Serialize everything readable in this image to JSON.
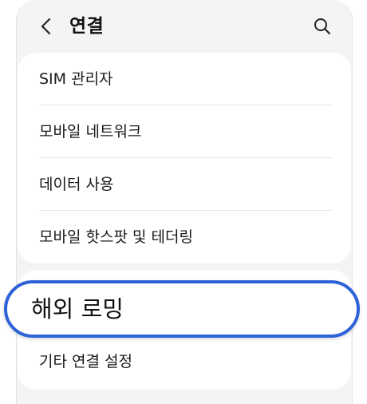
{
  "header": {
    "title": "연결",
    "back_icon": "chevron-left-icon",
    "search_icon": "search-icon"
  },
  "connection_menu": {
    "items": [
      {
        "label": "SIM 관리자"
      },
      {
        "label": "모바일 네트워크"
      },
      {
        "label": "데이터 사용"
      },
      {
        "label": "모바일 핫스팟 및 테더링"
      }
    ]
  },
  "highlighted_item": {
    "label": "해외 로밍",
    "highlight_color": "#2e63d8"
  },
  "more_menu": {
    "items": [
      {
        "label": "기타 연결 설정"
      }
    ]
  }
}
